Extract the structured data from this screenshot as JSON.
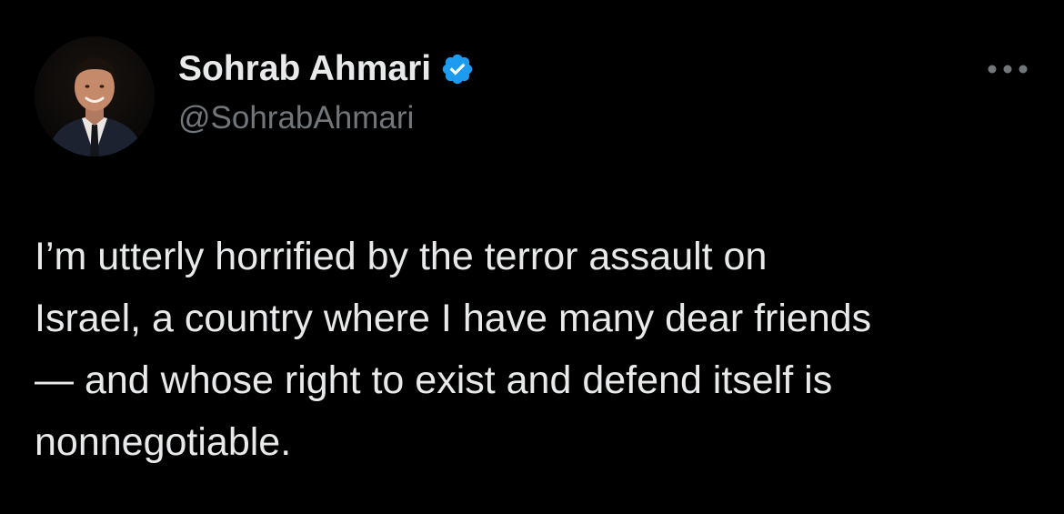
{
  "tweet": {
    "author": {
      "display_name": "Sohrab Ahmari",
      "handle": "@SohrabAhmari",
      "verified": true,
      "avatar_icon": "profile-photo-man-in-suit"
    },
    "more_icon": "more-options-icon",
    "text_lines": [
      "I’m utterly horrified by the terror assault on",
      "Israel, a country where I have many dear friends",
      "— and whose right to exist and defend itself is",
      "nonnegotiable."
    ]
  },
  "colors": {
    "background": "#000000",
    "primary_text": "#e7e9ea",
    "secondary_text": "#71767b",
    "verified_badge": "#1d9bf0"
  }
}
